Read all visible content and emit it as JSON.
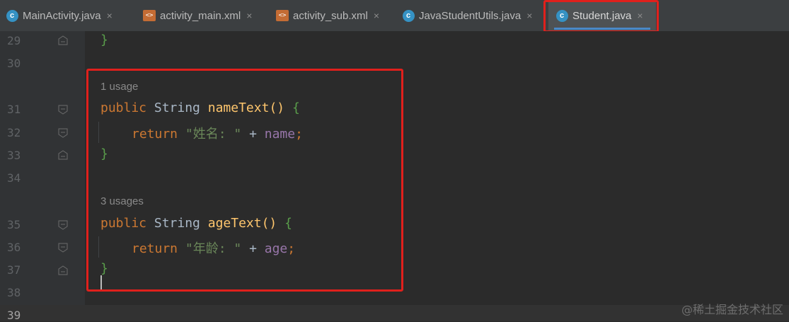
{
  "tabs": [
    {
      "label": "MainActivity.java",
      "icon": "class-icon"
    },
    {
      "label": "activity_main.xml",
      "icon": "xml-layout-icon"
    },
    {
      "label": "activity_sub.xml",
      "icon": "xml-layout-icon"
    },
    {
      "label": "JavaStudentUtils.java",
      "icon": "class-icon"
    },
    {
      "label": "Student.java",
      "icon": "class-icon",
      "active": true
    }
  ],
  "close_glyph": "×",
  "class_glyph": "c",
  "xml_glyph": "<>",
  "line_numbers": [
    "29",
    "30",
    "31",
    "32",
    "33",
    "34",
    "35",
    "36",
    "37",
    "38",
    "39"
  ],
  "code": {
    "l29": "}",
    "hint1": "1 usage",
    "l31": {
      "kw": "public",
      "type": " String ",
      "fn": "nameText",
      "paren": "() ",
      "brace": "{"
    },
    "l32": {
      "kw": "return",
      "str": "\"姓名: \"",
      "op": " + ",
      "fld": "name",
      "end": ";"
    },
    "l33": "}",
    "hint2": "3 usages",
    "l35": {
      "kw": "public",
      "type": " String ",
      "fn": "ageText",
      "paren": "() ",
      "brace": "{"
    },
    "l36": {
      "kw": "return",
      "str": "\"年龄: \"",
      "op": " + ",
      "fld": "age",
      "end": ";"
    },
    "l37": "}"
  },
  "watermark": "@稀土掘金技术社区",
  "colors": {
    "annotation_red": "#e0201c",
    "active_tab_underline": "#4a88c7"
  }
}
